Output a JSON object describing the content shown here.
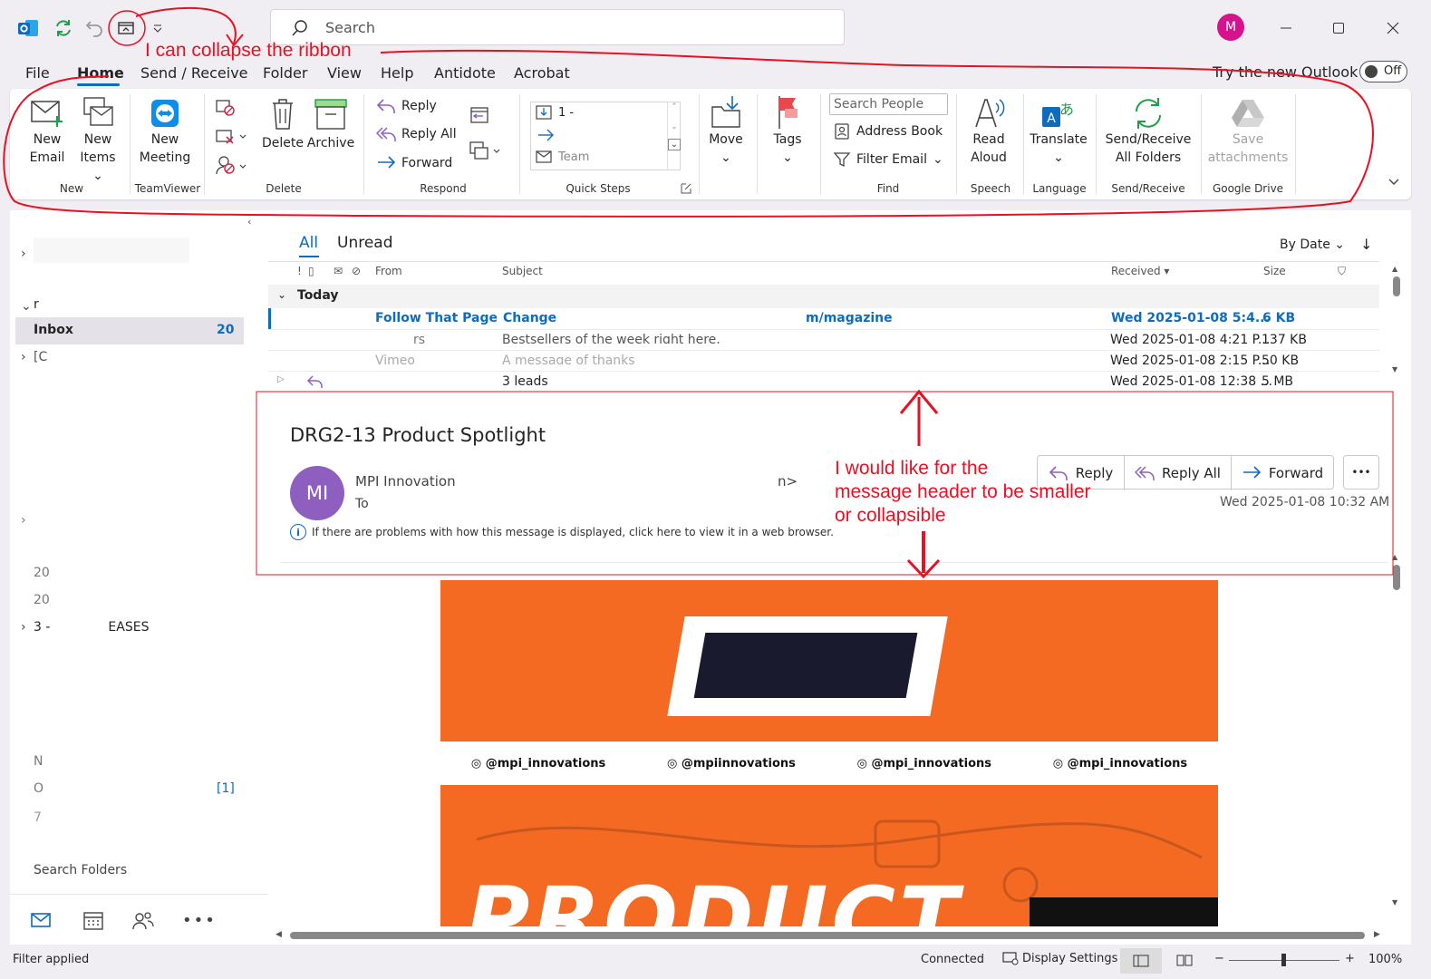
{
  "titlebar": {
    "search_placeholder": "Search",
    "avatar_initial": "M"
  },
  "menu": {
    "items": [
      "File",
      "Home",
      "Send / Receive",
      "Folder",
      "View",
      "Help",
      "Antidote",
      "Acrobat"
    ],
    "try_new_outlook": "Try the new Outlook",
    "toggle_label": "Off"
  },
  "ribbon": {
    "new_email": [
      "New",
      "Email"
    ],
    "new_items": [
      "New",
      "Items"
    ],
    "new_meeting": [
      "New",
      "Meeting"
    ],
    "delete": "Delete",
    "archive": "Archive",
    "reply": "Reply",
    "reply_all": "Reply All",
    "forward": "Forward",
    "quick_steps_item1": "1 -",
    "quick_steps_item3": "Team",
    "move": "Move",
    "tags": "Tags",
    "search_people_placeholder": "Search People",
    "address_book": "Address Book",
    "filter_email": "Filter Email",
    "read_aloud": [
      "Read",
      "Aloud"
    ],
    "translate": "Translate",
    "send_receive_all": [
      "Send/Receive",
      "All Folders"
    ],
    "save_attachments": [
      "Save",
      "attachments"
    ],
    "groups": {
      "new": "New",
      "teamviewer": "TeamViewer",
      "delete": "Delete",
      "respond": "Respond",
      "quick_steps": "Quick Steps",
      "find": "Find",
      "speech": "Speech",
      "language": "Language",
      "send_receive": "Send/Receive",
      "google_drive": "Google Drive"
    }
  },
  "nav": {
    "inbox": "Inbox",
    "inbox_count": "20",
    "item_r": "r",
    "item_c": "[C",
    "item_20a": "20",
    "item_20b": "20",
    "item_3": "3 -",
    "item_3_tail": "EASES",
    "item_n": "N",
    "item_o": "O",
    "item_o_count": "[1]",
    "item_7": "7",
    "search_folders": "Search Folders"
  },
  "list": {
    "tab_all": "All",
    "tab_unread": "Unread",
    "sort": "By Date",
    "columns": {
      "from": "From",
      "subject": "Subject",
      "received": "Received",
      "size": "Size"
    },
    "group_today": "Today",
    "rows": [
      {
        "from": "Follow That Page",
        "subject": "Change",
        "subject_tail": "m/magazine",
        "received": "Wed 2025-01-08 5:4...",
        "size": "6 KB"
      },
      {
        "from": "rs",
        "subject": "Bestsellers of the week right here.",
        "received": "Wed 2025-01-08 4:21 P...",
        "size": "137 KB"
      },
      {
        "from": "Vimeo",
        "subject": "A message of thanks",
        "received": "Wed 2025-01-08 2:15 P...",
        "size": "50 KB"
      },
      {
        "from": "",
        "subject": "3 leads",
        "received": "Wed 2025-01-08 12:38 ...",
        "size": "5 MB"
      }
    ]
  },
  "message": {
    "subject": "DRG2-13 Product Spotlight",
    "avatar": "MI",
    "sender": "MPI Innovation",
    "sender_tail": "n>",
    "to_label": "To",
    "date": "Wed 2025-01-08 10:32 AM",
    "info": "If there are problems with how this message is displayed, click here to view it in a web browser.",
    "reply": "Reply",
    "reply_all": "Reply All",
    "forward": "Forward",
    "more": "•••",
    "social": [
      "@mpi_innovations",
      "@mpiinnovations",
      "@mpi_innovations",
      "@mpi_innovations"
    ],
    "body_title": "PRODUCT"
  },
  "status": {
    "filter": "Filter applied",
    "connected": "Connected",
    "display_settings": "Display Settings",
    "zoom": "100%"
  },
  "annotations": {
    "ribbon_note": "I can collapse the ribbon",
    "header_note": [
      "I would like for the",
      "message header to be smaller",
      "or collapsible"
    ]
  },
  "colors": {
    "accent": "#0f6cbd",
    "annotation": "#e81123",
    "orange": "#f46a23",
    "avatar": "#8e5fbe",
    "profile": "#d4138c"
  }
}
